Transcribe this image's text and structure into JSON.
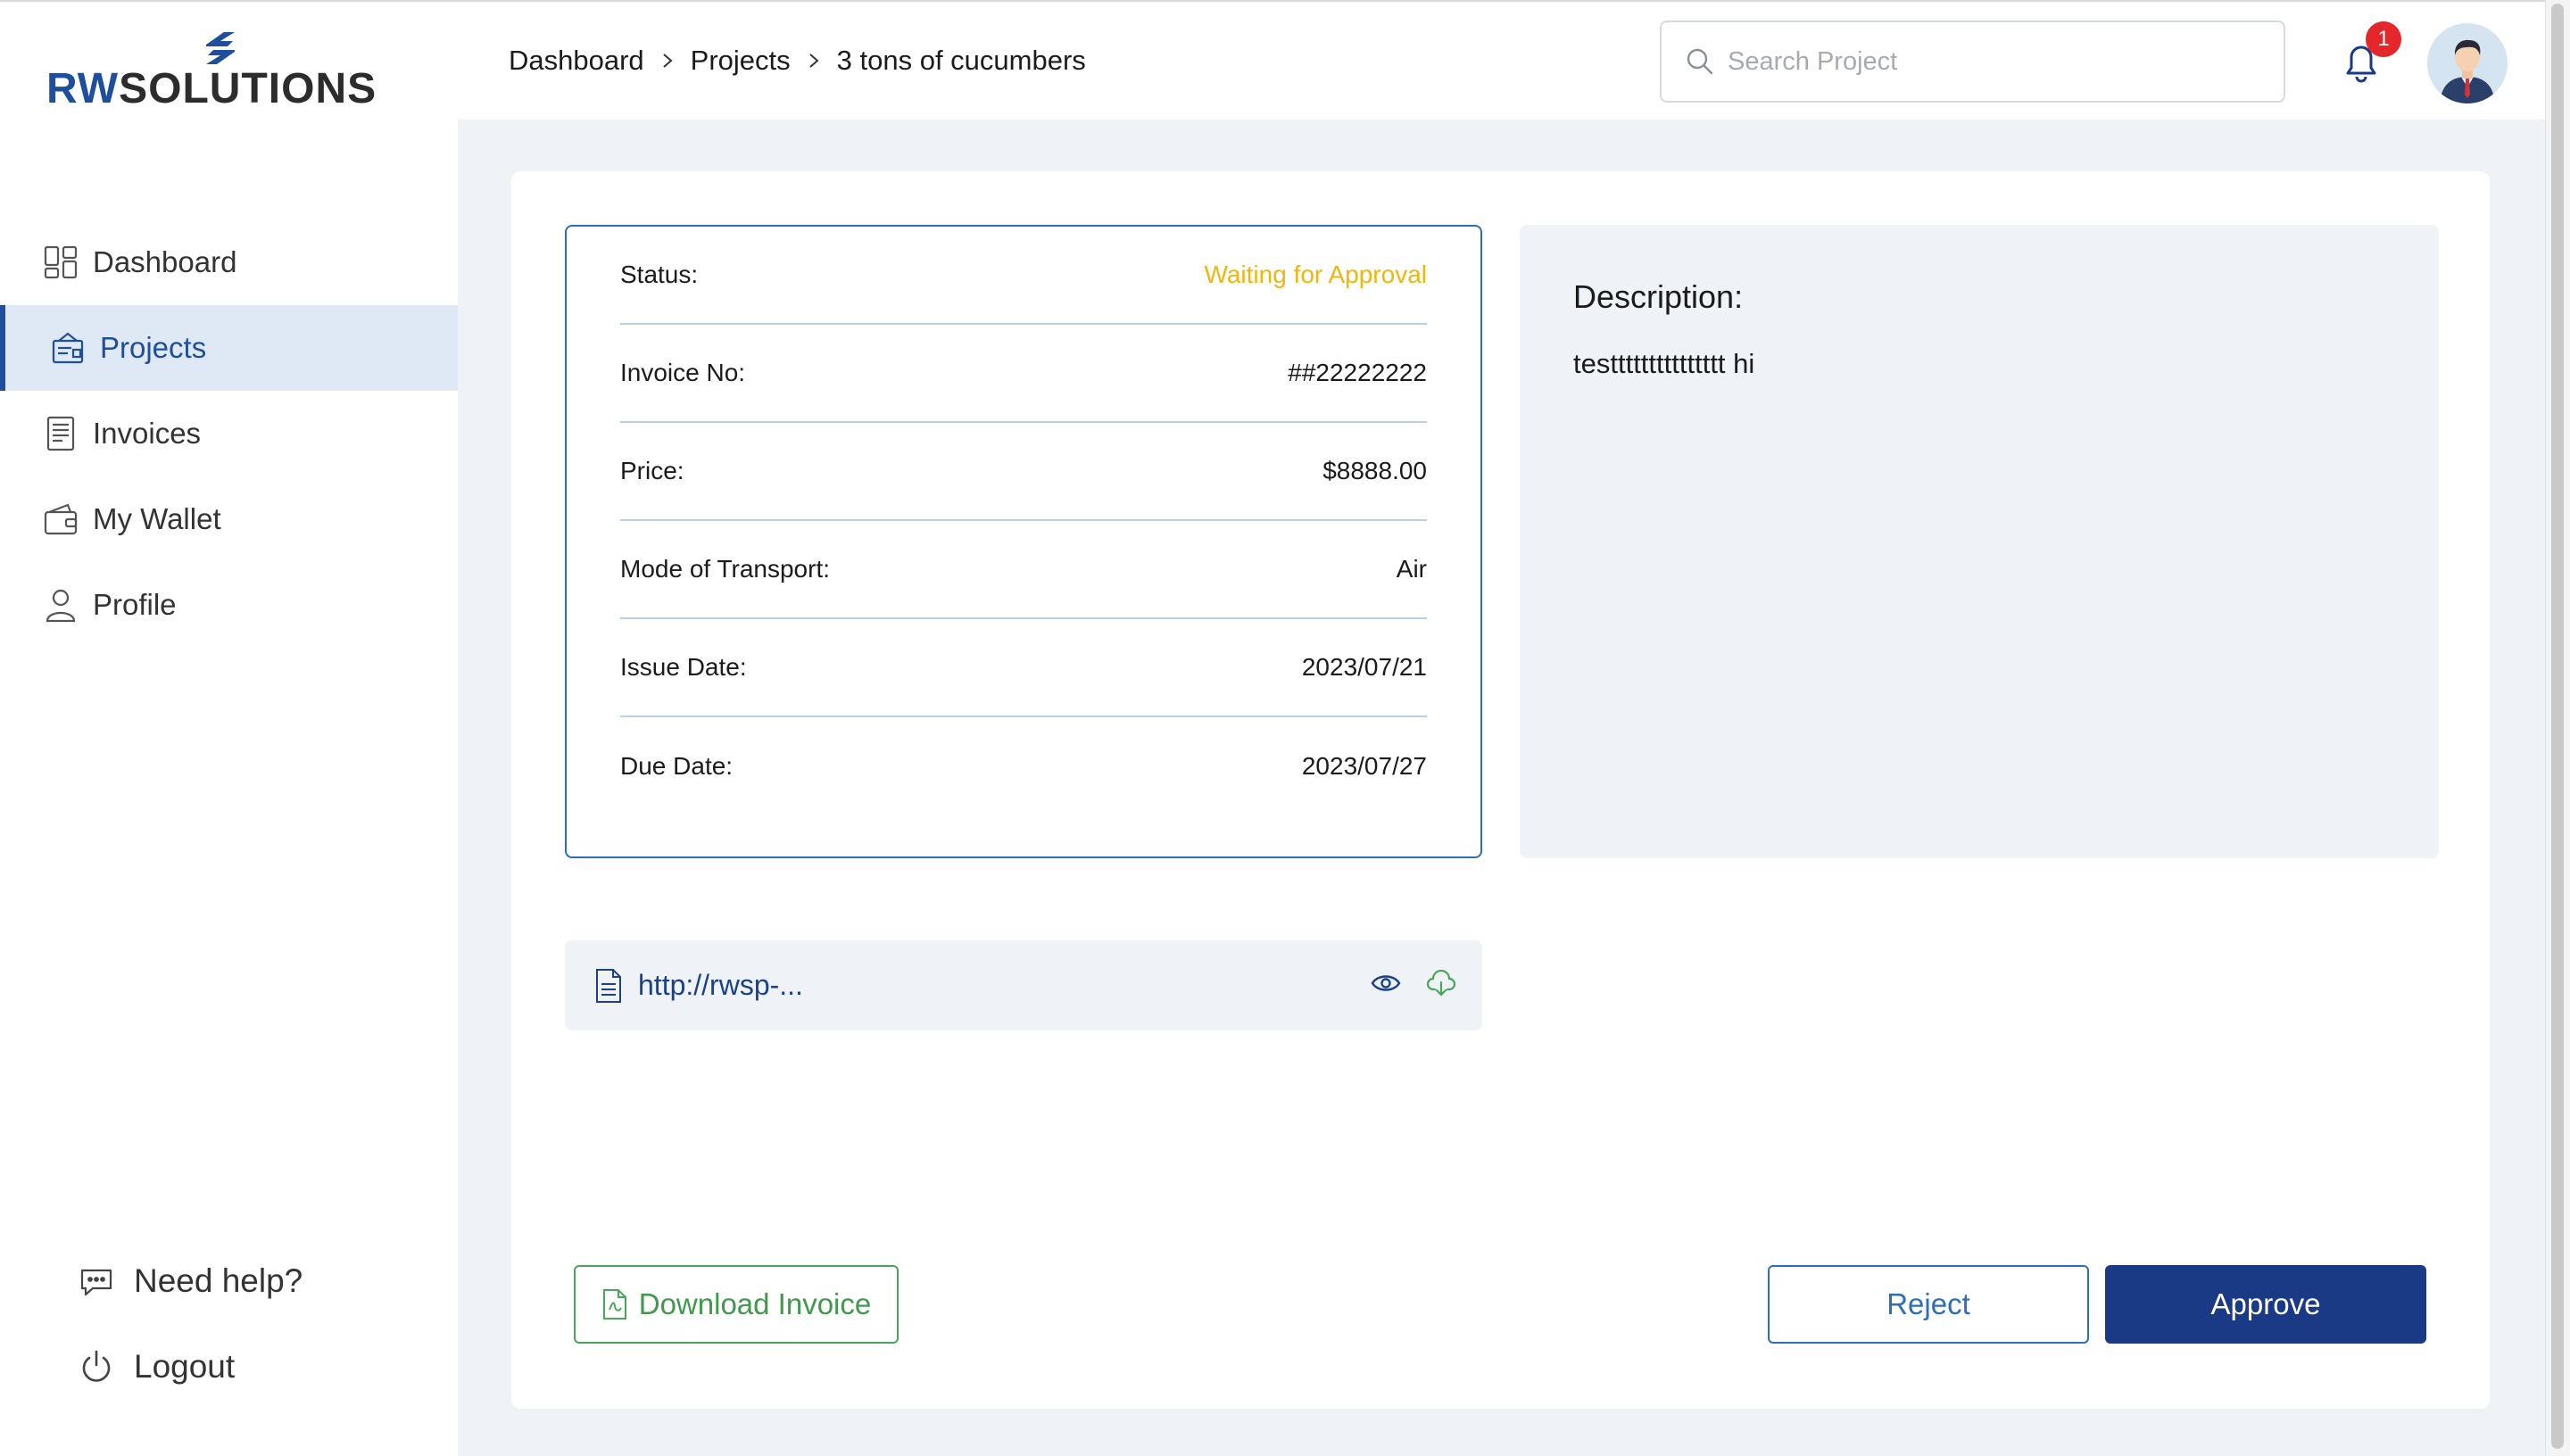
{
  "brand": {
    "logo_prefix": "RW",
    "logo_suffix": "SOLUTIONS",
    "accent": "#1f4f9c"
  },
  "sidebar": {
    "items": [
      {
        "label": "Dashboard",
        "icon": "dashboard-icon",
        "active": false
      },
      {
        "label": "Projects",
        "icon": "projects-icon",
        "active": true
      },
      {
        "label": "Invoices",
        "icon": "invoices-icon",
        "active": false
      },
      {
        "label": "My Wallet",
        "icon": "wallet-icon",
        "active": false
      },
      {
        "label": "Profile",
        "icon": "profile-icon",
        "active": false
      }
    ],
    "help_label": "Need help?",
    "logout_label": "Logout"
  },
  "header": {
    "breadcrumb": [
      "Dashboard",
      "Projects",
      "3 tons of cucumbers"
    ],
    "search_placeholder": "Search Project",
    "notification_count": "1"
  },
  "details": {
    "rows": [
      {
        "label": "Status:",
        "value": "Waiting for Approval",
        "color": "#f2b50a"
      },
      {
        "label": "Invoice No:",
        "value": "##22222222"
      },
      {
        "label": "Price:",
        "value": "$8888.00"
      },
      {
        "label": "Mode of Transport:",
        "value": "Air"
      },
      {
        "label": "Issue Date:",
        "value": "2023/07/21"
      },
      {
        "label": "Due Date:",
        "value": "2023/07/27"
      }
    ]
  },
  "description": {
    "title": "Description:",
    "body": "testtttttttttttttt hi"
  },
  "attachment": {
    "link_text": "http://rwsp-..."
  },
  "actions": {
    "download_label": "Download Invoice",
    "reject_label": "Reject",
    "approve_label": "Approve"
  },
  "colors": {
    "approve_bg": "#1a3a86",
    "download_green": "#3f9a4d",
    "status_yellow": "#f2b50a",
    "badge_red": "#e5262b"
  }
}
